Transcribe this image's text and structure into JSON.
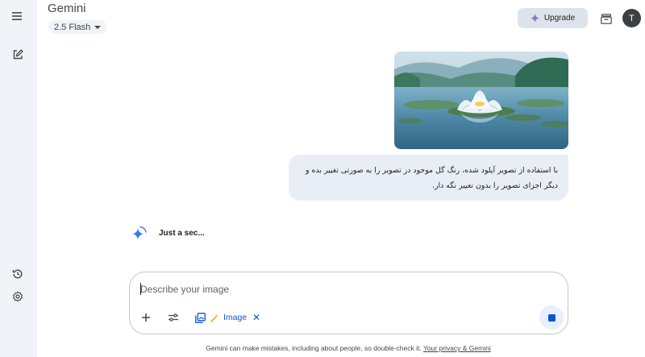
{
  "header": {
    "brand": "Gemini",
    "model_selector": "2.5 Flash",
    "upgrade_label": "Upgrade",
    "avatar_initial": "T"
  },
  "sidebar": {
    "icons": [
      "menu-icon",
      "new-chat-icon",
      "history-icon",
      "settings-icon"
    ]
  },
  "conversation": {
    "user_image": "lotus-on-lake-photo",
    "user_prompt_line1": "با استفاده از تصویر آپلود شده، رنگ گل موجود در تصویر را به صورتی تغییر بده و",
    "user_prompt_line2": "دیگر اجزای تصویر را بدون تغییر نگه دار.",
    "status_text": "Just a sec..."
  },
  "composer": {
    "placeholder": "Describe your image",
    "value": "",
    "tool_chip_label": "Image",
    "tool_chip_close": "✕"
  },
  "footer": {
    "disclaimer": "Gemini can make mistakes, including about people, so double-check it.",
    "privacy_link": "Your privacy & Gemini"
  },
  "colors": {
    "accent": "#0b57d0",
    "rail_bg": "#f0f4f9",
    "bubble_bg": "#e9eef6",
    "upgrade_bg": "#dde3ea"
  }
}
